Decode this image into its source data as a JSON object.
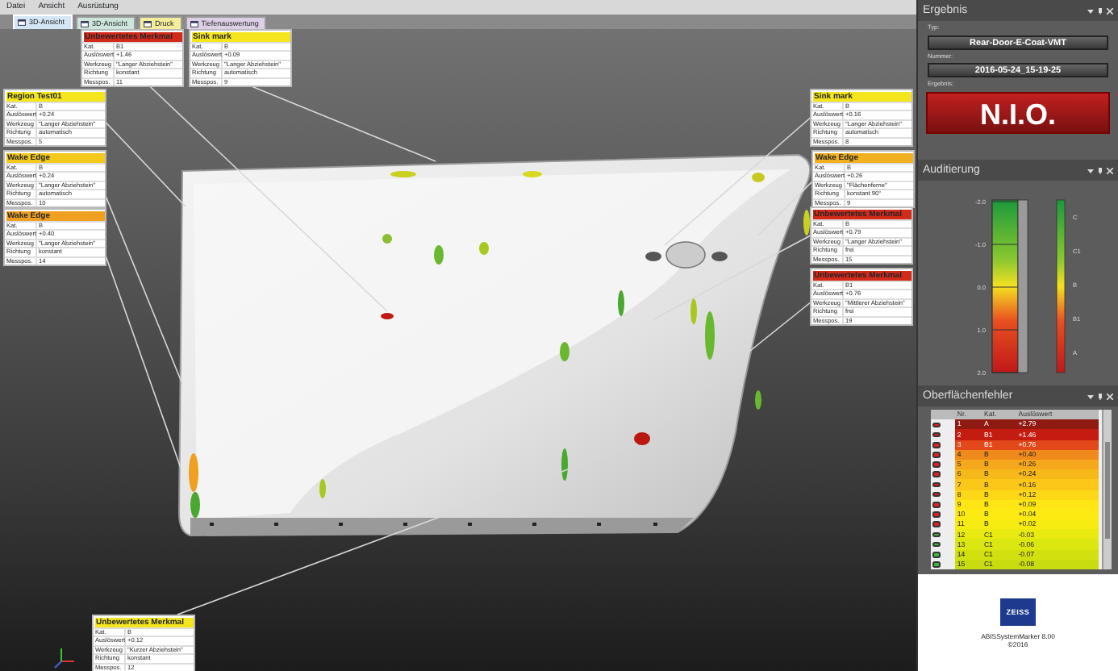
{
  "menu": [
    {
      "label": "Datei"
    },
    {
      "label": "Ansicht"
    },
    {
      "label": "Ausrüstung"
    }
  ],
  "tabs": [
    {
      "label": "3D-Ansicht",
      "selected": true,
      "color": "#d4e6f5"
    },
    {
      "label": "3D-Ansicht",
      "selected": false,
      "color": "#cde6dc"
    },
    {
      "label": "Druck",
      "selected": false,
      "color": "#f4ee9c"
    },
    {
      "label": "Tiefenauswertung",
      "selected": false,
      "color": "#ddd0e6"
    }
  ],
  "callouts": [
    {
      "title": "Unbewertetes Merkmal",
      "color": "#d42a1a",
      "fields": [
        {
          "label": "Kat.",
          "value": "B1"
        },
        {
          "label": "Auslöswert",
          "value": "+1.46"
        },
        {
          "label": "Werkzeug",
          "value": "\"Langer Abziehstein\""
        },
        {
          "label": "Richtung",
          "value": "konstant"
        },
        {
          "label": "Messpos.",
          "value": "11"
        }
      ]
    },
    {
      "title": "Sink mark",
      "color": "#f5e51c",
      "fields": [
        {
          "label": "Kat.",
          "value": "B"
        },
        {
          "label": "Auslöswert",
          "value": "+0.09"
        },
        {
          "label": "Werkzeug",
          "value": "\"Langer Abziehstein\""
        },
        {
          "label": "Richtung",
          "value": "automatisch"
        },
        {
          "label": "Messpos.",
          "value": "9"
        }
      ]
    },
    {
      "title": "Region Test01",
      "color": "#f5e51c",
      "fields": [
        {
          "label": "Kat.",
          "value": "B"
        },
        {
          "label": "Auslöswert",
          "value": "+0.24"
        },
        {
          "label": "Werkzeug",
          "value": "\"Langer Abziehstein\""
        },
        {
          "label": "Richtung",
          "value": "automatisch"
        },
        {
          "label": "Messpos.",
          "value": "5"
        }
      ]
    },
    {
      "title": "Wake Edge",
      "color": "#f5c81c",
      "fields": [
        {
          "label": "Kat.",
          "value": "B"
        },
        {
          "label": "Auslöswert",
          "value": "+0.24"
        },
        {
          "label": "Werkzeug",
          "value": "\"Langer Abziehstein\""
        },
        {
          "label": "Richtung",
          "value": "automatisch"
        },
        {
          "label": "Messpos.",
          "value": "10"
        }
      ]
    },
    {
      "title": "Wake Edge",
      "color": "#f0a020",
      "fields": [
        {
          "label": "Kat.",
          "value": "B"
        },
        {
          "label": "Auslöswert",
          "value": "+0.40"
        },
        {
          "label": "Werkzeug",
          "value": "\"Langer Abziehstein\""
        },
        {
          "label": "Richtung",
          "value": "konstant"
        },
        {
          "label": "Messpos.",
          "value": "14"
        }
      ]
    },
    {
      "title": "Unbewertetes Merkmal",
      "color": "#f5e51c",
      "fields": [
        {
          "label": "Kat.",
          "value": "B"
        },
        {
          "label": "Auslöswert",
          "value": "+0.12"
        },
        {
          "label": "Werkzeug",
          "value": "\"Kurzer Abziehstein\""
        },
        {
          "label": "Richtung",
          "value": "konstant"
        },
        {
          "label": "Messpos.",
          "value": "12"
        }
      ]
    },
    {
      "title": "Sink mark",
      "color": "#f5e51c",
      "fields": [
        {
          "label": "Kat.",
          "value": "B"
        },
        {
          "label": "Auslöswert",
          "value": "+0.16"
        },
        {
          "label": "Werkzeug",
          "value": "\"Langer Abziehstein\""
        },
        {
          "label": "Richtung",
          "value": "automatisch"
        },
        {
          "label": "Messpos.",
          "value": "8"
        }
      ]
    },
    {
      "title": "Wake Edge",
      "color": "#f0b020",
      "fields": [
        {
          "label": "Kat.",
          "value": "B"
        },
        {
          "label": "Auslöswert",
          "value": "+0.26"
        },
        {
          "label": "Werkzeug",
          "value": "\"Flächenferne\""
        },
        {
          "label": "Richtung",
          "value": "konstant 90°"
        },
        {
          "label": "Messpos.",
          "value": "9"
        }
      ]
    },
    {
      "title": "Unbewertetes Merkmal",
      "color": "#d42a1a",
      "fields": [
        {
          "label": "Kat.",
          "value": "B"
        },
        {
          "label": "Auslöswert",
          "value": "+0.79"
        },
        {
          "label": "Werkzeug",
          "value": "\"Langer Abziehstein\""
        },
        {
          "label": "Richtung",
          "value": "frei"
        },
        {
          "label": "Messpos.",
          "value": "15"
        }
      ]
    },
    {
      "title": "Unbewertetes Merkmal",
      "color": "#d42a1a",
      "fields": [
        {
          "label": "Kat.",
          "value": "B1"
        },
        {
          "label": "Auslöswert",
          "value": "+0.76"
        },
        {
          "label": "Werkzeug",
          "value": "\"Mittlerer Abziehstein\""
        },
        {
          "label": "Richtung",
          "value": "frei"
        },
        {
          "label": "Messpos.",
          "value": "19"
        }
      ]
    }
  ],
  "result_panel": {
    "title": "Ergebnis",
    "type_label": "Typ:",
    "type_value": "Rear-Door-E-Coat-VMT",
    "number_label": "Nummer:",
    "number_value": "2016-05-24_15-19-25",
    "result_label": "Ergebnis:",
    "result": "N.I.O.",
    "passed": false
  },
  "audit_panel": {
    "title": "Auditierung",
    "scale_labels": [
      "-2.0",
      "-1.0",
      "0.0",
      "1.0",
      "2.0"
    ],
    "category_labels": [
      "C",
      "C1",
      "B",
      "B1",
      "A"
    ]
  },
  "defects_panel": {
    "title": "Oberflächenfehler",
    "columns": [
      "Nr.",
      "Kat.",
      "Auslöswert"
    ],
    "rows": [
      {
        "ok": false,
        "color": "#8e1a12",
        "nr": "1",
        "kat": "A",
        "value": "+2.79"
      },
      {
        "ok": false,
        "color": "#c41c10",
        "nr": "2",
        "kat": "B1",
        "value": "+1.46"
      },
      {
        "ok": false,
        "color": "#e2481a",
        "nr": "3",
        "kat": "B1",
        "value": "+0.76"
      },
      {
        "ok": false,
        "color": "#f08a1c",
        "nr": "4",
        "kat": "B",
        "value": "+0.40"
      },
      {
        "ok": false,
        "color": "#f5a81c",
        "nr": "5",
        "kat": "B",
        "value": "+0.26"
      },
      {
        "ok": false,
        "color": "#f7b81a",
        "nr": "6",
        "kat": "B",
        "value": "+0.24"
      },
      {
        "ok": false,
        "color": "#fbc81a",
        "nr": "7",
        "kat": "B",
        "value": "+0.16"
      },
      {
        "ok": false,
        "color": "#fdd816",
        "nr": "8",
        "kat": "B",
        "value": "+0.12"
      },
      {
        "ok": false,
        "color": "#fde614",
        "nr": "9",
        "kat": "B",
        "value": "+0.09"
      },
      {
        "ok": false,
        "color": "#fcea12",
        "nr": "10",
        "kat": "B",
        "value": "+0.04"
      },
      {
        "ok": false,
        "color": "#f6ec12",
        "nr": "11",
        "kat": "B",
        "value": "+0.02"
      },
      {
        "ok": true,
        "color": "#e8ea10",
        "nr": "12",
        "kat": "C1",
        "value": "-0.03"
      },
      {
        "ok": true,
        "color": "#dce610",
        "nr": "13",
        "kat": "C1",
        "value": "-0.06"
      },
      {
        "ok": true,
        "color": "#d2e010",
        "nr": "14",
        "kat": "C1",
        "value": "-0.07"
      },
      {
        "ok": true,
        "color": "#c8dc10",
        "nr": "15",
        "kat": "C1",
        "value": "-0.08"
      }
    ]
  },
  "footer": {
    "logo": "ZEISS",
    "product": "ABISSystemMarker 8.00",
    "copyright": "©2016"
  }
}
